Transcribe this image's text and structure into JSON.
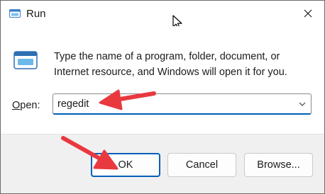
{
  "window": {
    "title": "Run",
    "title_icon": "run-icon",
    "close_icon": "close-icon"
  },
  "content": {
    "app_icon": "run-app-icon",
    "description": "Type the name of a program, folder, document, or Internet resource, and Windows will open it for you.",
    "open_label_prefix": "",
    "open_label_mnemonic": "O",
    "open_label_rest": "pen:",
    "open_value": "regedit"
  },
  "buttons": {
    "ok": "OK",
    "cancel": "Cancel",
    "browse": "Browse..."
  },
  "colors": {
    "accent": "#005fb8",
    "annotation_arrow": "#e8393f"
  }
}
